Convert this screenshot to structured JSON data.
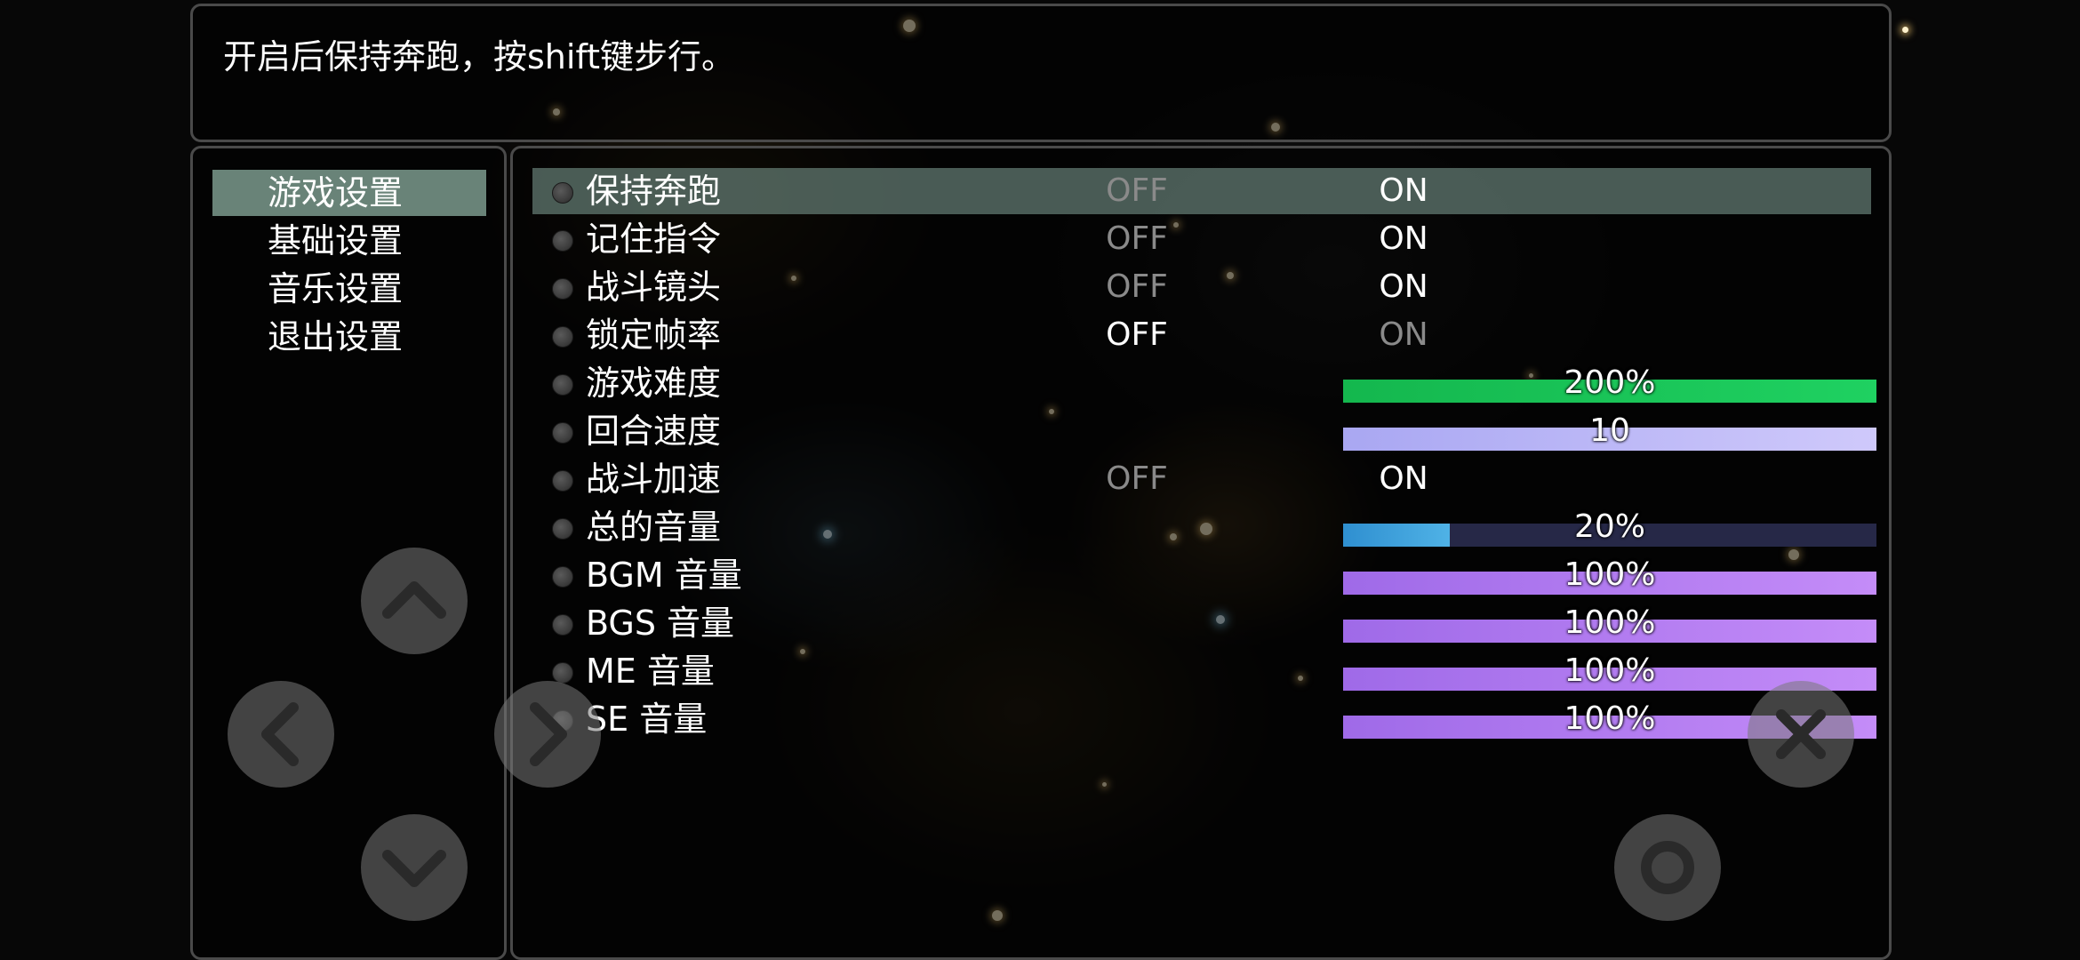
{
  "help": {
    "text": "开启后保持奔跑，按shift键步行。"
  },
  "categories": [
    {
      "label": "游戏设置",
      "selected": true
    },
    {
      "label": "基础设置",
      "selected": false
    },
    {
      "label": "音乐设置",
      "selected": false
    },
    {
      "label": "退出设置",
      "selected": false
    }
  ],
  "options": [
    {
      "label": "保持奔跑",
      "type": "toggle",
      "off": "OFF",
      "on": "ON",
      "value": "ON",
      "selected": true
    },
    {
      "label": "记住指令",
      "type": "toggle",
      "off": "OFF",
      "on": "ON",
      "value": "ON"
    },
    {
      "label": "战斗镜头",
      "type": "toggle",
      "off": "OFF",
      "on": "ON",
      "value": "ON"
    },
    {
      "label": "锁定帧率",
      "type": "toggle",
      "off": "OFF",
      "on": "ON",
      "value": "OFF"
    },
    {
      "label": "游戏难度",
      "type": "gauge",
      "text": "200%",
      "fraction": 1.0,
      "color": "#14b74e",
      "color2": "#1fd161"
    },
    {
      "label": "回合速度",
      "type": "gauge",
      "text": "10",
      "fraction": 1.0,
      "color": "#a9a7f2",
      "color2": "#cfc9fb"
    },
    {
      "label": "战斗加速",
      "type": "toggle",
      "off": "OFF",
      "on": "ON",
      "value": "ON"
    },
    {
      "label": "总的音量",
      "type": "gauge",
      "text": "20%",
      "fraction": 0.2,
      "color": "#2f8fd0",
      "color2": "#4fb2e6"
    },
    {
      "label": "BGM 音量",
      "type": "gauge",
      "text": "100%",
      "fraction": 1.0,
      "color": "#9f6ae8",
      "color2": "#c48cf8"
    },
    {
      "label": "BGS 音量",
      "type": "gauge",
      "text": "100%",
      "fraction": 1.0,
      "color": "#9f6ae8",
      "color2": "#c48cf8"
    },
    {
      "label": "ME 音量",
      "type": "gauge",
      "text": "100%",
      "fraction": 1.0,
      "color": "#9f6ae8",
      "color2": "#c48cf8"
    },
    {
      "label": "SE 音量",
      "type": "gauge",
      "text": "100%",
      "fraction": 1.0,
      "color": "#9f6ae8",
      "color2": "#c48cf8"
    }
  ],
  "touch_controls": {
    "up": "chevron-up-icon",
    "down": "chevron-down-icon",
    "left": "chevron-left-icon",
    "right": "chevron-right-icon",
    "cancel": "close-icon",
    "confirm": "circle-icon"
  },
  "colors": {
    "selected_category": "#8cafa0",
    "selected_row": "#78968c",
    "toggle_active": "#ffffff",
    "toggle_inactive": "#8a8a8a",
    "gauge_track": "#262847"
  }
}
